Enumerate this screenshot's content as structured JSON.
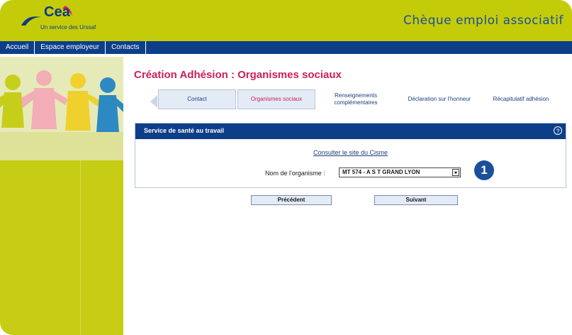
{
  "header": {
    "logo_text": "Cea",
    "logo_subtitle": "Un service des Urssaf",
    "app_title": "Chèque emploi associatif"
  },
  "nav": {
    "items": [
      {
        "label": "Accueil"
      },
      {
        "label": "Espace employeur"
      },
      {
        "label": "Contacts"
      }
    ]
  },
  "page": {
    "title": "Création Adhésion : Organismes sociaux"
  },
  "tabs": [
    {
      "label": "Contact",
      "state": "normal"
    },
    {
      "label": "Organismes sociaux",
      "state": "active"
    },
    {
      "label": "Renseignements complémentaires",
      "state": "inactive"
    },
    {
      "label": "Déclaration sur l'honneur",
      "state": "inactive"
    },
    {
      "label": "Récapitulatif adhésion",
      "state": "inactive"
    }
  ],
  "panel": {
    "title": "Service de santé au travail",
    "help_icon": "question-circle-icon",
    "link": "Consulter le site du Cisme",
    "org_label": "Nom de l'organisme :",
    "org_value": "MT 574 - A S T GRAND LYON"
  },
  "callout": {
    "number": "1"
  },
  "buttons": {
    "previous": "Précédent",
    "next": "Suivant"
  },
  "colors": {
    "brand_green": "#c4cc0a",
    "navy": "#0d3e88",
    "title_pink": "#cc1f58",
    "tab_bg": "#e3ebf6"
  }
}
